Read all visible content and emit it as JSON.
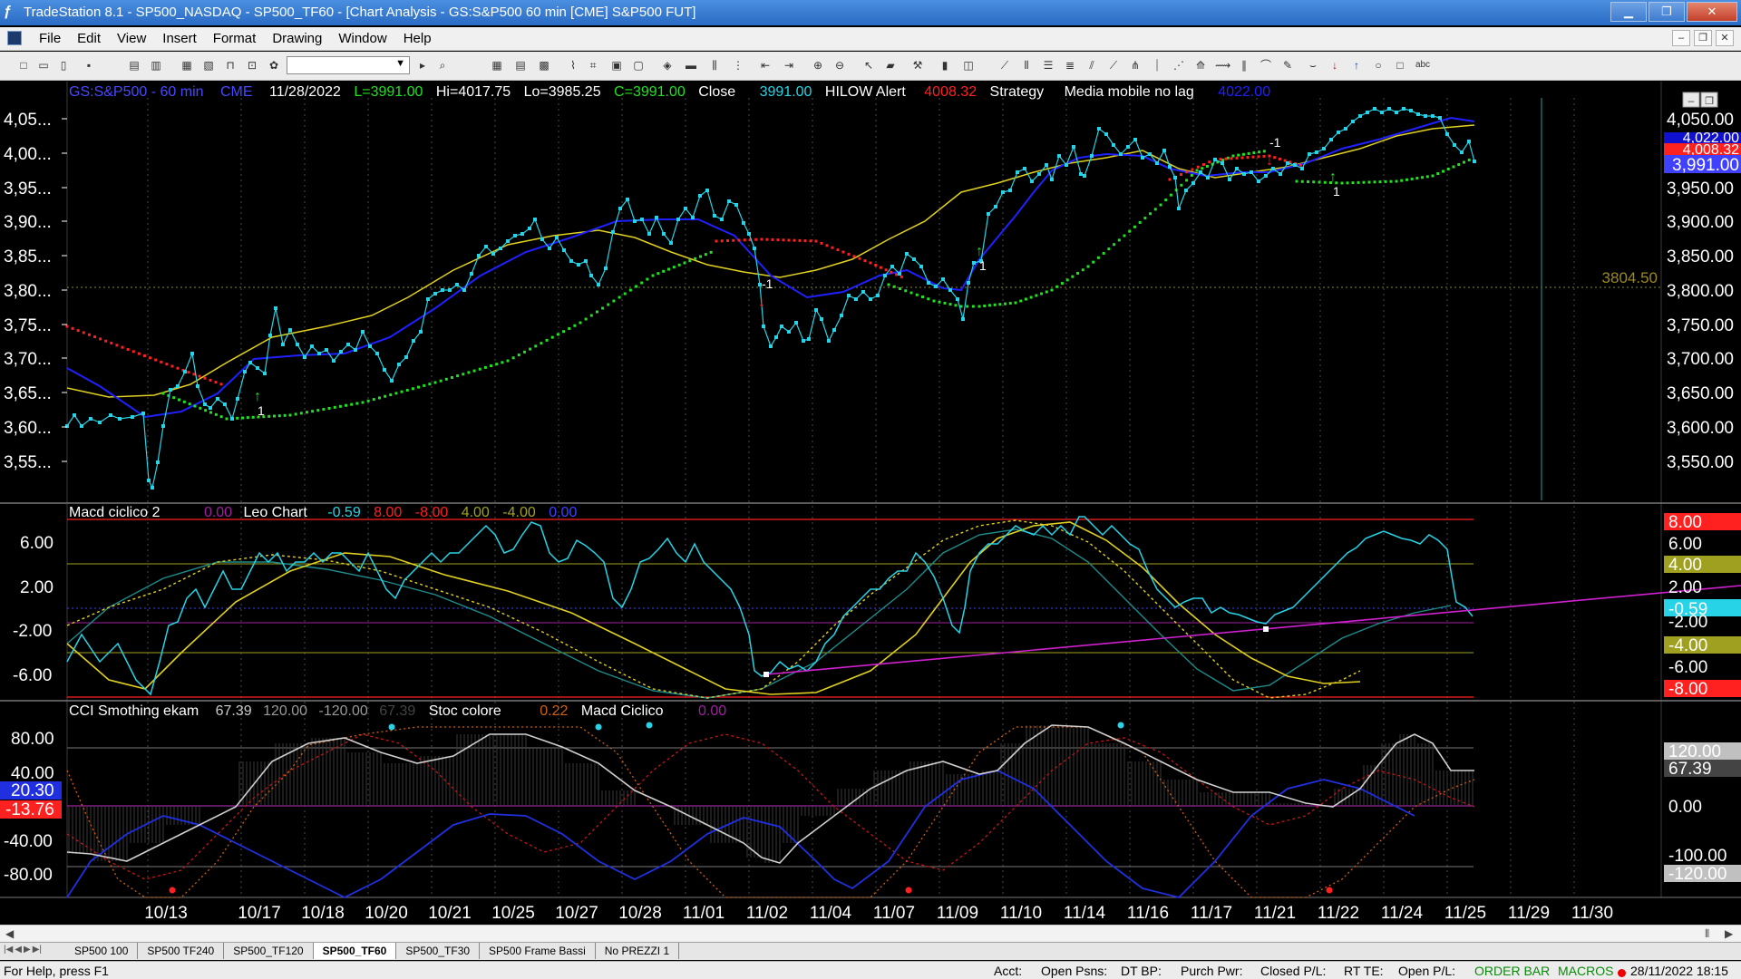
{
  "window": {
    "title": "TradeStation 8.1 - SP500_NASDAQ - SP500_TF60 - [Chart Analysis - GS:S&P500  60 min  [CME] S&P500 FUT]",
    "buttons": [
      "minimize",
      "restore",
      "close"
    ]
  },
  "menu": {
    "items": [
      "File",
      "Edit",
      "View",
      "Insert",
      "Format",
      "Drawing",
      "Window",
      "Help"
    ]
  },
  "price_panel": {
    "symbol": "GS:S&P500 - 60 min",
    "exchange": "CME",
    "date": "11/28/2022",
    "last": "L=3991.00",
    "high": "Hi=4017.75",
    "low": "Lo=3985.25",
    "close_label": "C=3991.00",
    "close_word": "Close",
    "close_value": "3991.00",
    "hilow_label": "HILOW Alert",
    "hilow_value": "4008.32",
    "strategy_label": "Strategy",
    "mm_label": "Media mobile no lag",
    "mm_value": "4022.00",
    "hline_label": "3804.50",
    "axis_labels": [
      "4,050.00",
      "4,000.00",
      "3,950.00",
      "3,900.00",
      "3,850.00",
      "3,800.00",
      "3,750.00",
      "3,700.00",
      "3,650.00",
      "3,600.00",
      "3,550.00"
    ],
    "left_axis_labels": [
      "4,05...",
      "4,00...",
      "3,95...",
      "3,90...",
      "3,85...",
      "3,80...",
      "3,75...",
      "3,70...",
      "3,65...",
      "3,60...",
      "3,55..."
    ],
    "badge_close": "3,991.00",
    "badge_mm": "4,022.00",
    "badge_hilow": "4,008.32",
    "strategy_marks": [
      "1",
      "-1",
      "1",
      "-1",
      "1"
    ]
  },
  "macd_panel": {
    "name": "Macd ciclico 2",
    "v1": "0.00",
    "leo_label": "Leo Chart",
    "v2": "-0.59",
    "v3": "8.00",
    "v4": "-8.00",
    "v5": "4.00",
    "v6": "-4.00",
    "v7": "0.00",
    "left_axis": [
      "6.00",
      "2.00",
      "-2.00",
      "-6.00"
    ],
    "right_axis": [
      "6.00",
      "2.00",
      "-2.00",
      "-6.00"
    ],
    "badge_8": "8.00",
    "badge_4": "4.00",
    "badge_m059": "-0.59",
    "badge_m4": "-4.00",
    "badge_m8": "-8.00"
  },
  "cci_panel": {
    "name": "CCI Smothing ekam",
    "v1": "67.39",
    "v2": "120.00",
    "v3": "-120.00",
    "v4": "67.39",
    "stoc_label": "Stoc colore",
    "stoc_value": "0.22",
    "macd_label": "Macd Ciclico",
    "macd_value": "0.00",
    "left_axis": [
      "80.00",
      "40.00",
      "-40.00",
      "-80.00"
    ],
    "left_badge_blue": "20.30",
    "left_badge_red": "-13.76",
    "right_axis": [
      "0.00"
    ],
    "badge_120": "120.00",
    "badge_6739": "67.39",
    "badge_m120": "-120.00",
    "badge_m100": "-100.00"
  },
  "x_axis": [
    "10/13",
    "10/17",
    "10/18",
    "10/20",
    "10/21",
    "10/25",
    "10/27",
    "10/28",
    "11/01",
    "11/02",
    "11/04",
    "11/07",
    "11/09",
    "11/10",
    "11/14",
    "11/16",
    "11/17",
    "11/21",
    "11/22",
    "11/24",
    "11/25",
    "11/29",
    "11/30"
  ],
  "tabs": [
    "SP500 100",
    "SP500 TF240",
    "SP500_TF120",
    "SP500_TF60",
    "SP500_TF30",
    "SP500 Frame Bassi",
    "No PREZZI 1"
  ],
  "active_tab": "SP500_TF60",
  "status": {
    "help": "For Help, press F1",
    "acct": "Acct:",
    "open_psns": "Open Psns:",
    "dt_bp": "DT BP:",
    "purch_pwr": "Purch Pwr:",
    "closed_pl": "Closed P/L:",
    "rt_te": "RT TE:",
    "open_pl": "Open P/L:",
    "order_bar": "ORDER BAR",
    "macros": "MACROS",
    "datetime": "28/11/2022 18:15"
  },
  "colors": {
    "price_dots": "#27d3e6",
    "ma_blue": "#2020ff",
    "ma_yellow": "#e0d020",
    "hilow_green": "#22e022",
    "hilow_red": "#ff2020",
    "magenta": "#d020d0",
    "grid": "#5a5a5a"
  }
}
